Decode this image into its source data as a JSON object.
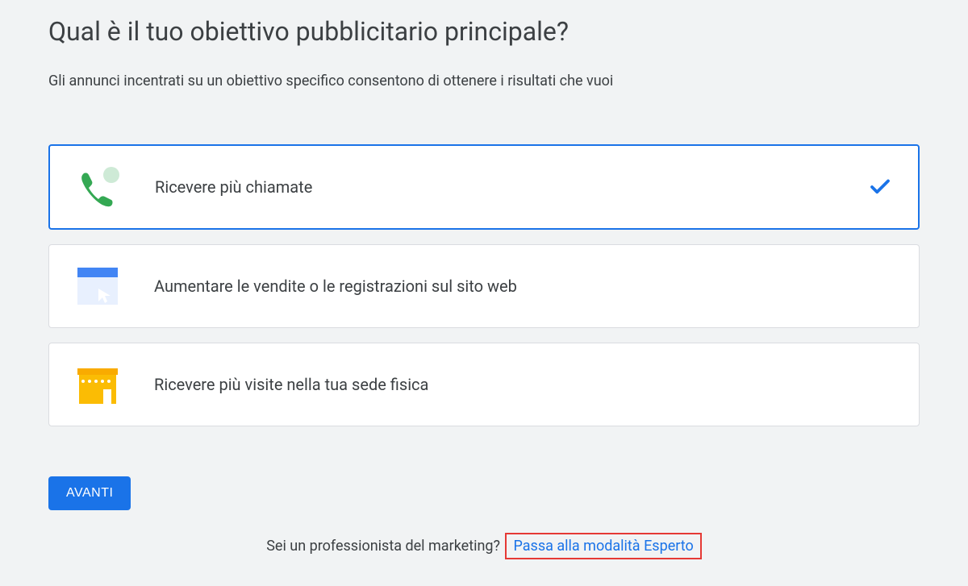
{
  "title": "Qual è il tuo obiettivo pubblicitario principale?",
  "subtitle": "Gli annunci incentrati su un obiettivo specifico consentono di ottenere i risultati che vuoi",
  "options": [
    {
      "label": "Ricevere più chiamate",
      "selected": true
    },
    {
      "label": "Aumentare le vendite o le registrazioni sul sito web",
      "selected": false
    },
    {
      "label": "Ricevere più visite nella tua sede fisica",
      "selected": false
    }
  ],
  "next_button": "AVANTI",
  "footer_question": "Sei un professionista del marketing?",
  "expert_link": "Passa alla modalità Esperto"
}
